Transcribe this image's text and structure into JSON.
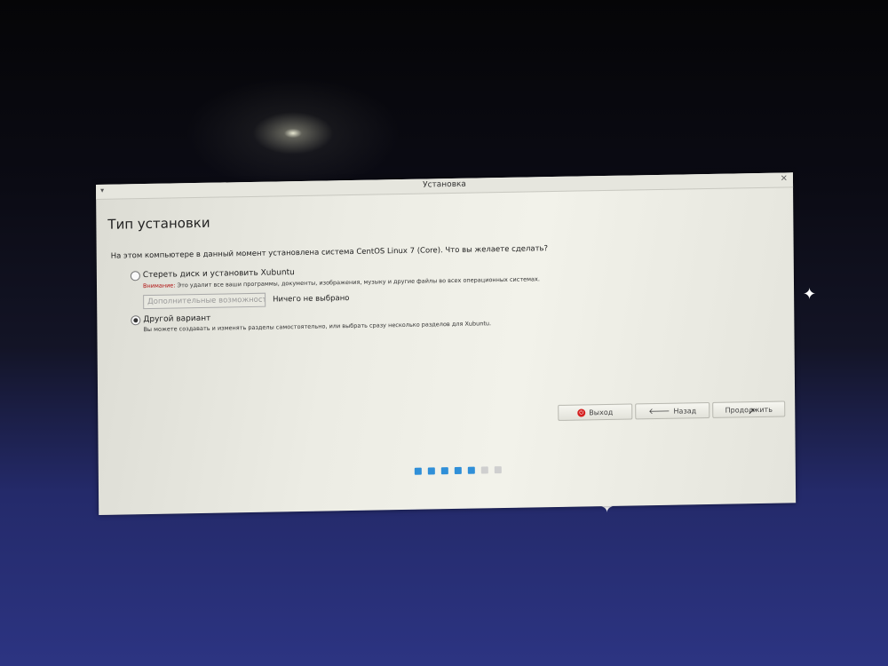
{
  "window": {
    "title": "Установка",
    "menu_icon": "▾",
    "close_icon": "×"
  },
  "page": {
    "title": "Тип установки",
    "question": "На этом компьютере в данный момент установлена система CentOS Linux 7 (Core). Что вы желаете сделать?"
  },
  "options": {
    "erase": {
      "label": "Стереть диск и установить Xubuntu",
      "selected": false,
      "warning_key": "Внимание:",
      "warning_text": " Это удалит все ваши программы, документы, изображения, музыку и другие файлы во всех операционных системах.",
      "advanced_button": "Дополнительные возможности...",
      "advanced_status": "Ничего не выбрано"
    },
    "other": {
      "label": "Другой вариант",
      "selected": true,
      "description": "Вы можете создавать и изменять разделы самостоятельно, или выбрать сразу несколько разделов для Xubuntu."
    }
  },
  "buttons": {
    "exit": "Выход",
    "back": "Назад",
    "continue": "Продолжить"
  },
  "progress": {
    "total_steps": 7,
    "completed_steps": 5
  },
  "colors": {
    "accent": "#2f8fd8",
    "warning": "#b01010",
    "exit_icon": "#d52020"
  }
}
